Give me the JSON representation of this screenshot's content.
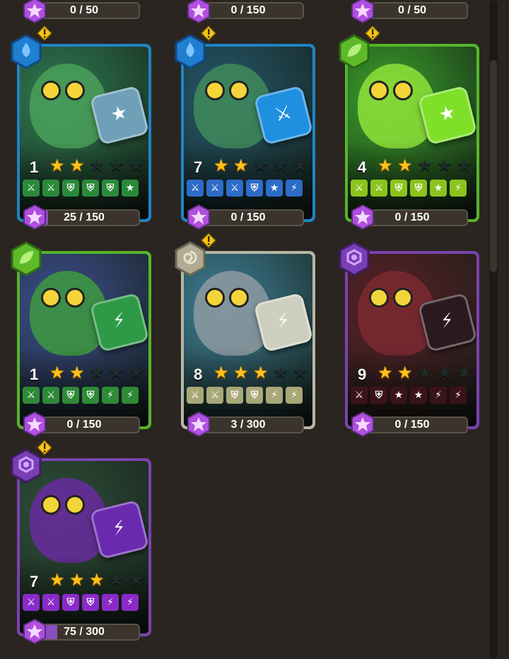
{
  "top_progress": [
    "0 / 50",
    "0 / 150",
    "0 / 50"
  ],
  "cards": [
    {
      "element": "water",
      "element_icon": "water-drop-icon",
      "border": "#1f84c4",
      "bg": "#2f7b52",
      "monster": "#4aa05a",
      "dice": "#6fa0b8",
      "dice_glyph": "★",
      "level": "1",
      "stars": 2,
      "abilities": [
        "sword",
        "sword",
        "shield",
        "shield",
        "shield",
        "star"
      ],
      "ab_color": "#2a8a3a",
      "progress": "25 / 150",
      "fill": 0.17,
      "alert": true
    },
    {
      "element": "water",
      "element_icon": "water-drop-icon",
      "border": "#1f84c4",
      "bg": "#24576b",
      "monster": "#3f8b5c",
      "dice": "#1f8fe0",
      "dice_glyph": "⚔",
      "level": "7",
      "stars": 2,
      "abilities": [
        "sword",
        "sword",
        "sword",
        "shield",
        "star",
        "bolt"
      ],
      "ab_color": "#2d6cc8",
      "progress": "0 / 150",
      "fill": 0,
      "alert": true
    },
    {
      "element": "nature",
      "element_icon": "leaf-icon",
      "border": "#56b52a",
      "bg": "#3aa02a",
      "monster": "#8fe23a",
      "dice": "#7fe02a",
      "dice_glyph": "★",
      "level": "4",
      "stars": 2,
      "abilities": [
        "sword",
        "sword",
        "shield",
        "shield",
        "star",
        "bolt"
      ],
      "ab_color": "#8ac41c",
      "progress": "0 / 150",
      "fill": 0,
      "alert": true
    },
    {
      "element": "nature",
      "element_icon": "leaf-icon",
      "border": "#56b52a",
      "bg": "#3c4e8e",
      "monster": "#3d9a3f",
      "dice": "#2e9a48",
      "dice_glyph": "⚡",
      "level": "1",
      "stars": 2,
      "abilities": [
        "sword",
        "sword",
        "shield",
        "shield",
        "bolt",
        "bolt"
      ],
      "ab_color": "#2e8a36",
      "progress": "0 / 150",
      "fill": 0,
      "alert": false
    },
    {
      "element": "air",
      "element_icon": "swirl-icon",
      "border": "#b7b7a4",
      "bg": "#3e7f97",
      "monster": "#8e9aa0",
      "dice": "#cfcfc0",
      "dice_glyph": "⚡",
      "level": "8",
      "stars": 3,
      "abilities": [
        "sword",
        "sword",
        "shield",
        "shield",
        "bolt",
        "bolt"
      ],
      "ab_color": "#a8a878",
      "progress": "3 / 300",
      "fill": 0.01,
      "alert": true
    },
    {
      "element": "dark",
      "element_icon": "dark-eye-icon",
      "border": "#7a42b2",
      "bg": "#5a1f26",
      "monster": "#7a2a30",
      "dice": "#2a1a20",
      "dice_glyph": "⚡",
      "level": "9",
      "stars": 2,
      "abilities": [
        "sword",
        "shield",
        "star",
        "star",
        "bolt",
        "bolt"
      ],
      "ab_color": "#3a1318",
      "progress": "0 / 150",
      "fill": 0,
      "alert": false
    },
    {
      "element": "dark",
      "element_icon": "dark-eye-icon",
      "border": "#7a42b2",
      "bg": "#2f4f3a",
      "monster": "#6a2aa0",
      "dice": "#6a2ab0",
      "dice_glyph": "⚡",
      "level": "7",
      "stars": 3,
      "abilities": [
        "sword",
        "sword",
        "shield",
        "shield",
        "bolt",
        "bolt"
      ],
      "ab_color": "#8a2ac8",
      "progress": "75 / 300",
      "fill": 0.25,
      "alert": true
    }
  ]
}
